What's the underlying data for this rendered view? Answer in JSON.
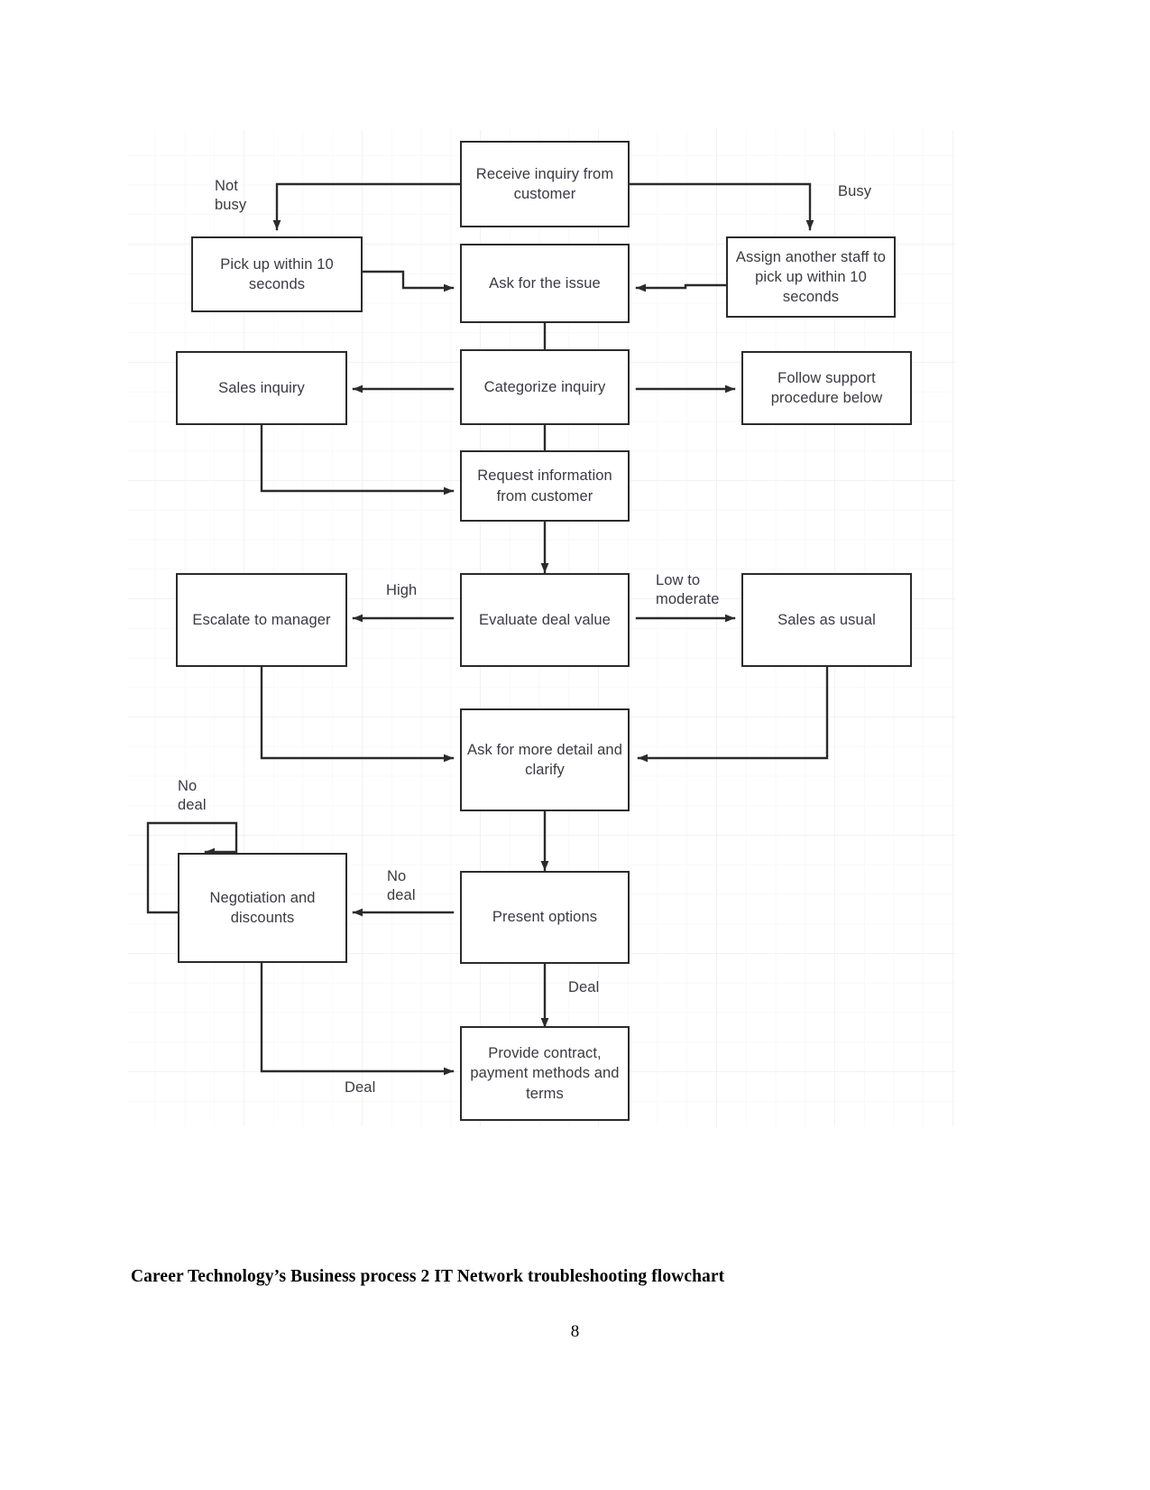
{
  "document": {
    "caption": "Career Technology’s Business process 2 IT Network troubleshooting flowchart",
    "page_number": "8"
  },
  "chart_data": {
    "type": "diagram",
    "diagram_kind": "flowchart",
    "title": "Career Technology’s Business process 2 IT Network troubleshooting flowchart",
    "colors": {
      "node_border": "#2b2b2b",
      "node_fill": "#ffffff",
      "node_text": "#3a3a42",
      "connector": "#2b2b2b",
      "grid_major": "#f2f2f2",
      "grid_minor": "#f8f8f8",
      "page_background": "#ffffff"
    },
    "nodes": [
      {
        "id": "receive",
        "label": "Receive inquiry from customer"
      },
      {
        "id": "notbusy",
        "label": "Pick up within 10 seconds"
      },
      {
        "id": "busy",
        "label": "Assign another staff to pick up within 10 seconds"
      },
      {
        "id": "askissue",
        "label": "Ask for the issue"
      },
      {
        "id": "categorize",
        "label": "Categorize inquiry"
      },
      {
        "id": "salesinq",
        "label": "Sales inquiry"
      },
      {
        "id": "support",
        "label": "Follow support procedure below"
      },
      {
        "id": "requestinfo",
        "label": "Request information from customer"
      },
      {
        "id": "evaluate",
        "label": "Evaluate deal value"
      },
      {
        "id": "escalate",
        "label": "Escalate to manager"
      },
      {
        "id": "salesusual",
        "label": "Sales as usual"
      },
      {
        "id": "askdetail",
        "label": "Ask for more detail and clarify"
      },
      {
        "id": "negotiate",
        "label": "Negotiation and discounts"
      },
      {
        "id": "present",
        "label": "Present options"
      },
      {
        "id": "contract",
        "label": "Provide contract, payment methods and terms"
      }
    ],
    "edges": [
      {
        "from": "receive",
        "to": "notbusy",
        "label": "Not\nbusy"
      },
      {
        "from": "receive",
        "to": "busy",
        "label": "Busy"
      },
      {
        "from": "notbusy",
        "to": "askissue",
        "label": ""
      },
      {
        "from": "busy",
        "to": "askissue",
        "label": ""
      },
      {
        "from": "askissue",
        "to": "categorize",
        "label": ""
      },
      {
        "from": "categorize",
        "to": "salesinq",
        "label": ""
      },
      {
        "from": "categorize",
        "to": "support",
        "label": ""
      },
      {
        "from": "categorize",
        "to": "requestinfo",
        "label": ""
      },
      {
        "from": "salesinq",
        "to": "requestinfo",
        "label": ""
      },
      {
        "from": "requestinfo",
        "to": "evaluate",
        "label": ""
      },
      {
        "from": "evaluate",
        "to": "escalate",
        "label": "High"
      },
      {
        "from": "evaluate",
        "to": "salesusual",
        "label": "Low to\nmoderate"
      },
      {
        "from": "escalate",
        "to": "askdetail",
        "label": ""
      },
      {
        "from": "salesusual",
        "to": "askdetail",
        "label": ""
      },
      {
        "from": "askdetail",
        "to": "present",
        "label": ""
      },
      {
        "from": "present",
        "to": "negotiate",
        "label": "No\ndeal"
      },
      {
        "from": "negotiate",
        "to": "negotiate",
        "label": "No\ndeal"
      },
      {
        "from": "present",
        "to": "contract",
        "label": "Deal"
      },
      {
        "from": "negotiate",
        "to": "contract",
        "label": "Deal"
      }
    ],
    "edge_labels": [
      {
        "id": "not-busy",
        "text": "Not\nbusy"
      },
      {
        "id": "busy",
        "text": "Busy"
      },
      {
        "id": "high",
        "text": "High"
      },
      {
        "id": "low-moderate",
        "text": "Low to\nmoderate"
      },
      {
        "id": "no-deal-loop",
        "text": "No\ndeal"
      },
      {
        "id": "no-deal",
        "text": "No\ndeal"
      },
      {
        "id": "deal-vertical",
        "text": "Deal"
      },
      {
        "id": "deal-horizontal",
        "text": "Deal"
      }
    ]
  }
}
